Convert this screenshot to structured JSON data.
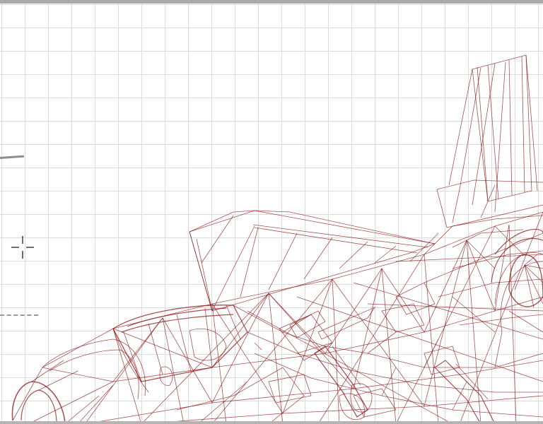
{
  "viewport": {
    "view": "3D wireframe",
    "grid": true,
    "model_color": "#8b1a1a",
    "grid_color": "#dcdcdc"
  },
  "cursor": {
    "icon": "crosshair-move-icon"
  }
}
